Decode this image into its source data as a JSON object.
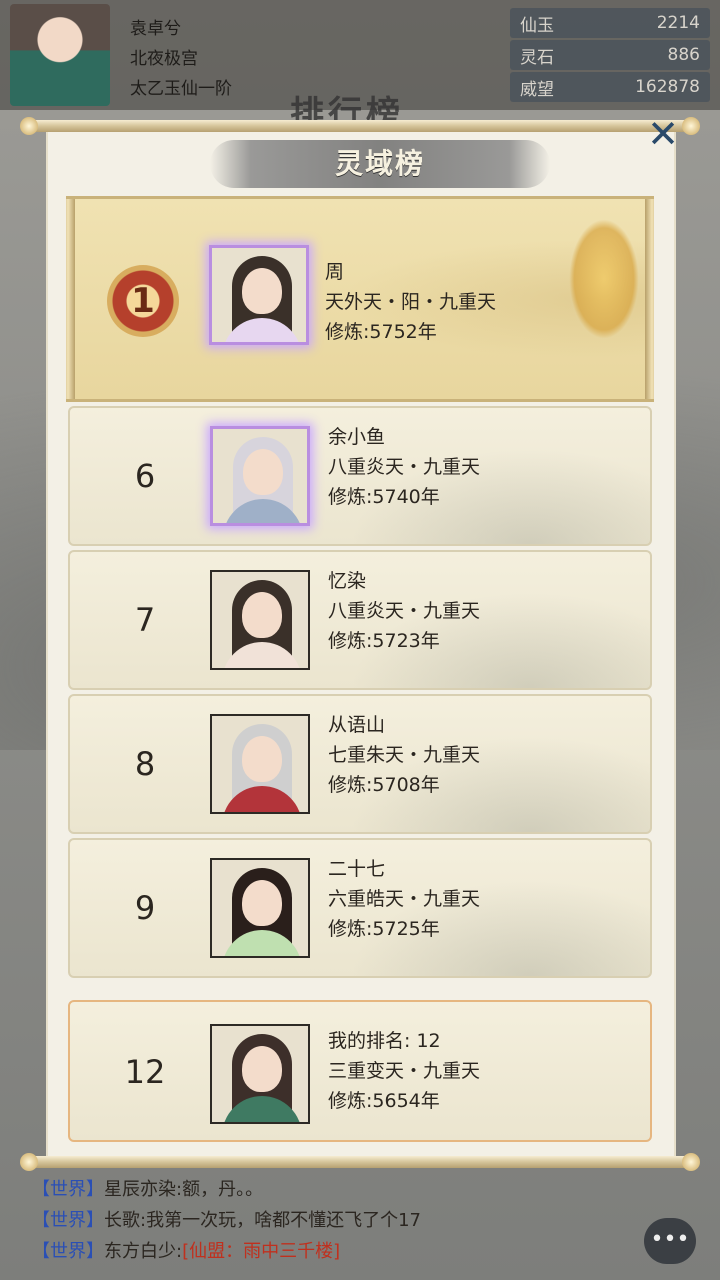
{
  "player": {
    "name": "袁卓兮",
    "sect": "北夜极宫",
    "realm": "太乙玉仙一阶"
  },
  "resources": [
    {
      "label": "仙玉",
      "value": "2214"
    },
    {
      "label": "灵石",
      "value": "886"
    },
    {
      "label": "威望",
      "value": "162878"
    }
  ],
  "background_title": "排行榜",
  "panel": {
    "title": "灵域榜",
    "close_icon": "close-icon"
  },
  "ranking": [
    {
      "rank": "1",
      "name": "周",
      "realm": "天外天・阳・九重天",
      "cultivation": "修炼:5752年",
      "robe_color": "#e7d7f0"
    },
    {
      "rank": "6",
      "name": "余小鱼",
      "realm": "八重炎天・九重天",
      "cultivation": "修炼:5740年",
      "robe_color": "#9fb0c8"
    },
    {
      "rank": "7",
      "name": "忆染",
      "realm": "八重炎天・九重天",
      "cultivation": "修炼:5723年",
      "robe_color": "#f1e2d8"
    },
    {
      "rank": "8",
      "name": "从语山",
      "realm": "七重朱天・九重天",
      "cultivation": "修炼:5708年",
      "robe_color": "#b3343a"
    },
    {
      "rank": "9",
      "name": "二十七",
      "realm": "六重皓天・九重天",
      "cultivation": "修炼:5725年",
      "robe_color": "#bfe0b0"
    }
  ],
  "my_rank": {
    "rank": "12",
    "label": "我的排名: 12",
    "realm": "三重变天・九重天",
    "cultivation": "修炼:5654年",
    "robe_color": "#3f7a62"
  },
  "chat": [
    {
      "tag": "【世界】",
      "sender": "星辰亦染:",
      "message": "额，丹。。",
      "extra": ""
    },
    {
      "tag": "【世界】",
      "sender": "长歌:",
      "message": "我第一次玩，啥都不懂还飞了个17",
      "extra": ""
    },
    {
      "tag": "【世界】",
      "sender": "东方白少:",
      "message": "",
      "extra": "[仙盟：雨中三千楼]"
    }
  ],
  "chat_button_icon": "chat-bubble-icon"
}
